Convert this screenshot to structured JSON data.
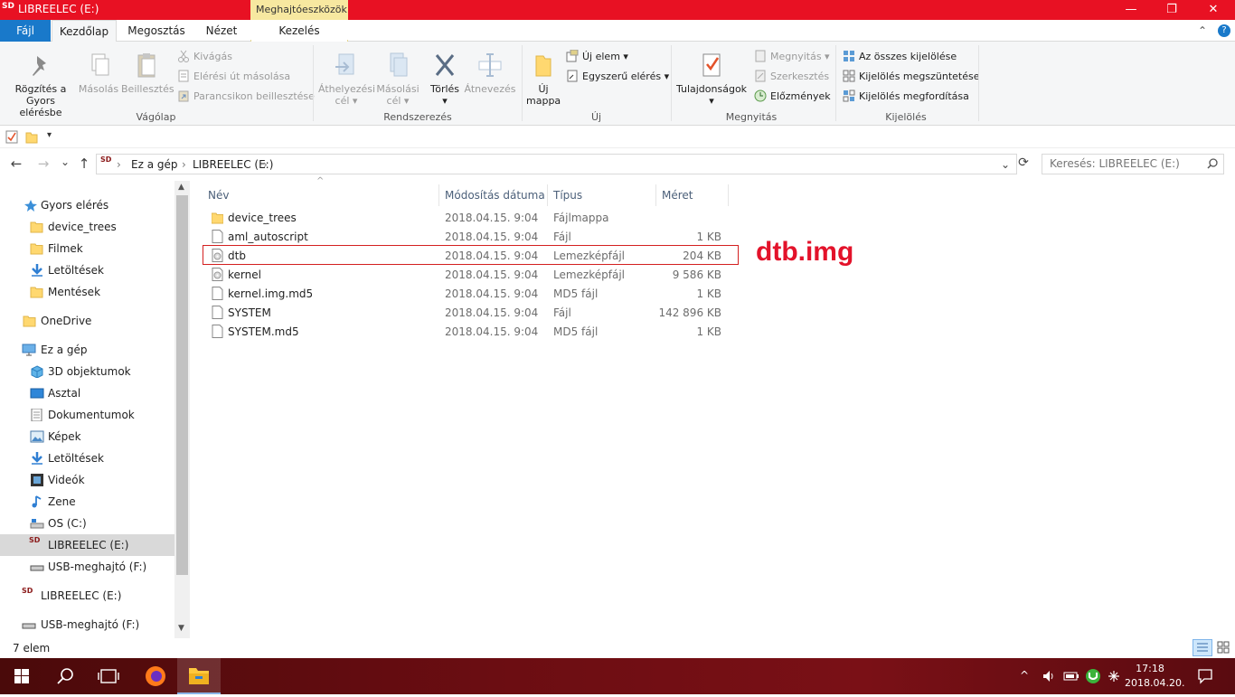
{
  "window": {
    "title": "LIBREELEC (E:)",
    "sd_label": "SD",
    "context_tab": "Meghajtóeszközök",
    "buttons": {
      "minimize": "—",
      "maximize": "❐",
      "close": "✕"
    }
  },
  "tabs": [
    {
      "label": "Fájl"
    },
    {
      "label": "Kezdőlap"
    },
    {
      "label": "Megosztás"
    },
    {
      "label": "Nézet"
    },
    {
      "label": "Kezelés"
    }
  ],
  "ribbon": {
    "groups": {
      "clipboard": "Vágólap",
      "organize": "Rendszerezés",
      "new": "Új",
      "open": "Megnyitás",
      "select": "Kijelölés"
    },
    "pin_line1": "Rögzítés a",
    "pin_line2": "Gyors elérésbe",
    "copy": "Másolás",
    "paste": "Beillesztés",
    "cut": "Kivágás",
    "copy_path": "Elérési út másolása",
    "paste_shortcut": "Parancsikon beillesztése",
    "move_to_line1": "Áthelyezési",
    "move_to_line2": "cél ▾",
    "copy_to_line1": "Másolási",
    "copy_to_line2": "cél ▾",
    "delete": "Törlés",
    "delete_arrow": "▾",
    "rename": "Átnevezés",
    "new_folder_line1": "Új",
    "new_folder_line2": "mappa",
    "new_item": "Új elem ▾",
    "easy_access": "Egyszerű elérés ▾",
    "properties": "Tulajdonságok",
    "properties_arrow": "▾",
    "open": "Megnyitás ▾",
    "edit": "Szerkesztés",
    "history": "Előzmények",
    "select_all": "Az összes kijelölése",
    "select_none": "Kijelölés megszüntetése",
    "invert_selection": "Kijelölés megfordítása",
    "collapse": "⌃",
    "help": "?"
  },
  "qat": {
    "dropdown": "▾"
  },
  "nav": {
    "back": "←",
    "forward": "→",
    "recent": "⌄",
    "up": "↑",
    "crumbs": [
      "Ez a gép",
      "LIBREELEC (E:)"
    ],
    "sep": "›",
    "refresh": "⟳",
    "addr_dropdown": "⌄",
    "search_placeholder": "Keresés: LIBREELEC (E:)"
  },
  "sidebar": {
    "items": [
      {
        "label": "Gyors elérés",
        "icon": "star-icon"
      },
      {
        "label": "device_trees",
        "icon": "folder-icon"
      },
      {
        "label": "Filmek",
        "icon": "folder-icon"
      },
      {
        "label": "Letöltések",
        "icon": "download-icon"
      },
      {
        "label": "Mentések",
        "icon": "folder-icon"
      },
      {
        "label": "OneDrive",
        "icon": "folder-icon"
      },
      {
        "label": "Ez a gép",
        "icon": "computer-icon"
      },
      {
        "label": "3D objektumok",
        "icon": "cube-icon"
      },
      {
        "label": "Asztal",
        "icon": "desktop-icon"
      },
      {
        "label": "Dokumentumok",
        "icon": "document-icon"
      },
      {
        "label": "Képek",
        "icon": "pictures-icon"
      },
      {
        "label": "Letöltések",
        "icon": "download-icon"
      },
      {
        "label": "Videók",
        "icon": "video-icon"
      },
      {
        "label": "Zene",
        "icon": "music-icon"
      },
      {
        "label": "OS (C:)",
        "icon": "drive-icon"
      },
      {
        "label": "LIBREELEC (E:)",
        "icon": "sd-card-icon"
      },
      {
        "label": "USB-meghajtó (F:)",
        "icon": "usb-drive-icon"
      },
      {
        "label": "LIBREELEC (E:)",
        "icon": "sd-card-icon"
      },
      {
        "label": "USB-meghajtó (F:)",
        "icon": "usb-drive-icon"
      }
    ]
  },
  "columns": {
    "name": "Név",
    "date": "Módosítás dátuma",
    "type": "Típus",
    "size": "Méret"
  },
  "files": [
    {
      "name": "device_trees",
      "date": "2018.04.15. 9:04",
      "type": "Fájlmappa",
      "size": "",
      "icon": "folder-icon"
    },
    {
      "name": "aml_autoscript",
      "date": "2018.04.15. 9:04",
      "type": "Fájl",
      "size": "1 KB",
      "icon": "file-icon"
    },
    {
      "name": "dtb",
      "date": "2018.04.15. 9:04",
      "type": "Lemezképfájl",
      "size": "204 KB",
      "icon": "disc-image-icon"
    },
    {
      "name": "kernel",
      "date": "2018.04.15. 9:04",
      "type": "Lemezképfájl",
      "size": "9 586 KB",
      "icon": "disc-image-icon"
    },
    {
      "name": "kernel.img.md5",
      "date": "2018.04.15. 9:04",
      "type": "MD5 fájl",
      "size": "1 KB",
      "icon": "file-icon"
    },
    {
      "name": "SYSTEM",
      "date": "2018.04.15. 9:04",
      "type": "Fájl",
      "size": "142 896 KB",
      "icon": "file-icon"
    },
    {
      "name": "SYSTEM.md5",
      "date": "2018.04.15. 9:04",
      "type": "MD5 fájl",
      "size": "1 KB",
      "icon": "file-icon"
    }
  ],
  "annotation": "dtb.img",
  "status": {
    "count": "7 elem"
  },
  "taskbar": {
    "time": "17:18",
    "date": "2018.04.20.",
    "tray_chevron": "^"
  },
  "colors": {
    "titlebar": "#e81123",
    "file_tab": "#1979ca",
    "annotation": "#e3122a",
    "highlight": "#d42020"
  }
}
